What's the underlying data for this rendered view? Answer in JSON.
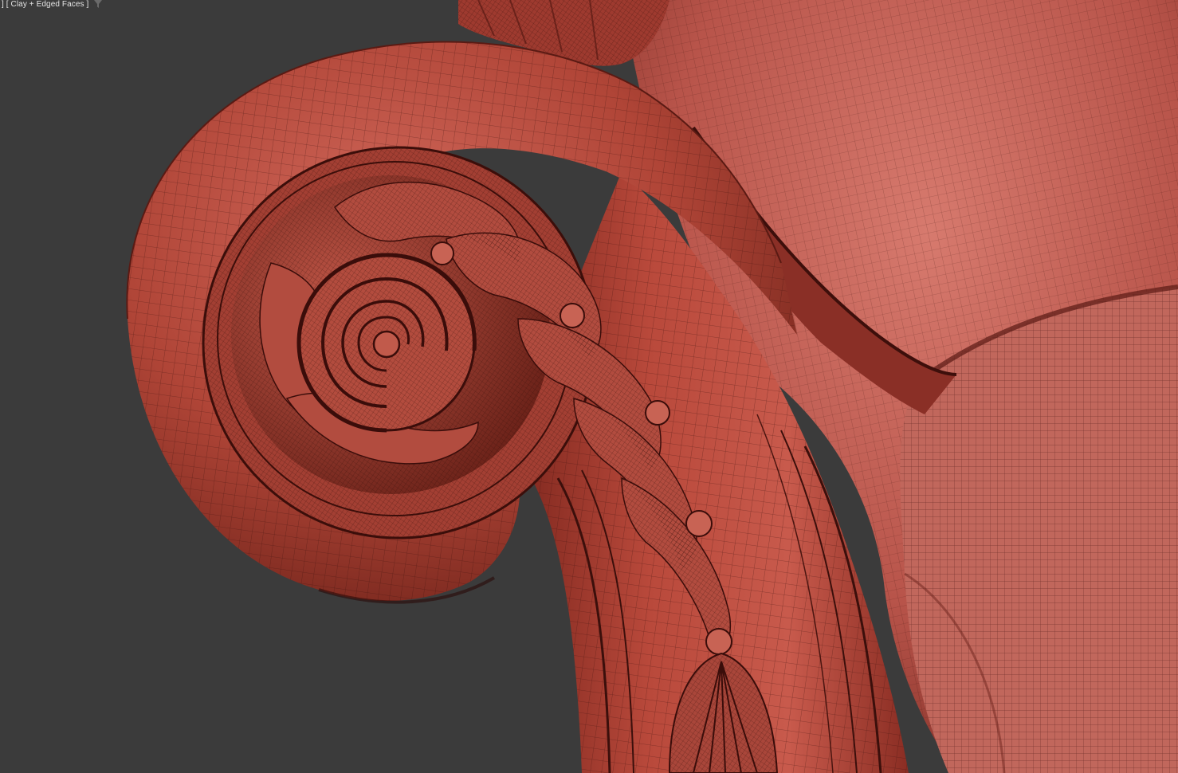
{
  "viewport": {
    "label": "] [ Clay + Edged Faces ]",
    "filter_icon": "funnel-filter-icon",
    "background": "#3b3b3b"
  },
  "model": {
    "clay_color": "#b44a3c",
    "clay_shadow": "#5e1e18",
    "clay_highlight": "#d8766a",
    "edge_color": "#4a1612"
  }
}
